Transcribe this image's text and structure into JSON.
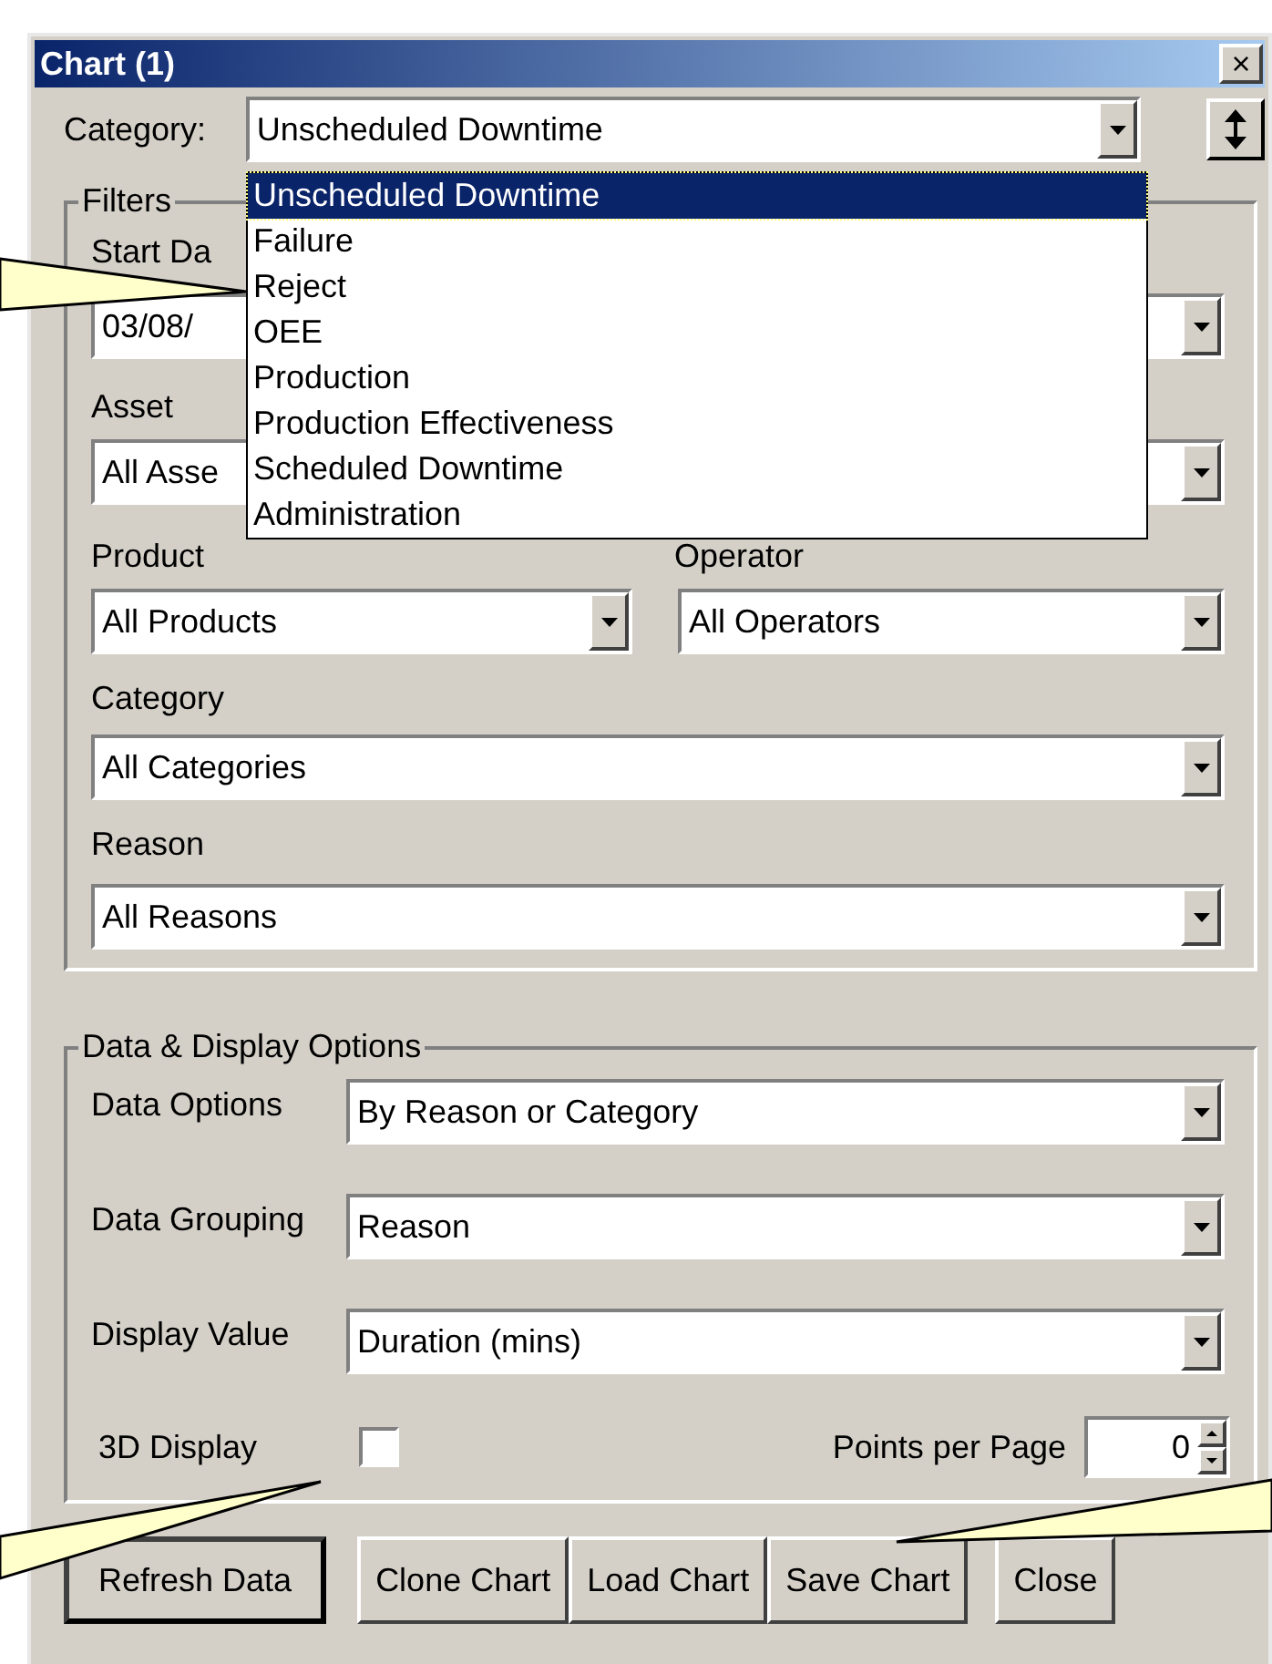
{
  "window": {
    "title": "Chart (1)",
    "close": "×"
  },
  "category": {
    "label": "Category:",
    "value": "Unscheduled Downtime",
    "expanded": true,
    "options": [
      {
        "label": "Unscheduled Downtime",
        "selected": true
      },
      {
        "label": "Failure",
        "selected": false
      },
      {
        "label": "Reject",
        "selected": false
      },
      {
        "label": "OEE",
        "selected": false
      },
      {
        "label": "Production",
        "selected": false
      },
      {
        "label": "Production Effectiveness",
        "selected": false
      },
      {
        "label": "Scheduled Downtime",
        "selected": false
      },
      {
        "label": "Administration",
        "selected": false
      }
    ]
  },
  "filters": {
    "title": "Filters",
    "start_label": "Start Da",
    "start_value": "03/08/",
    "asset_label": "Asset",
    "asset_value": "All Asse",
    "product_label": "Product",
    "product_value": "All Products",
    "operator_label": "Operator",
    "operator_value": "All Operators",
    "category_label": "Category",
    "category_value": "All Categories",
    "reason_label": "Reason",
    "reason_value": "All Reasons"
  },
  "display": {
    "title": "Data & Display Options",
    "rows": [
      {
        "label": "Data Options",
        "value": "By Reason or Category"
      },
      {
        "label": "Data Grouping",
        "value": "Reason"
      },
      {
        "label": "Display Value",
        "value": "Duration (mins)"
      }
    ],
    "three_d_label": "3D Display",
    "three_d_checked": false,
    "points_label": "Points per Page",
    "points_value": "0"
  },
  "buttons": [
    {
      "label": "Refresh Data",
      "default": true
    },
    {
      "label": "Clone Chart",
      "default": false
    },
    {
      "label": "Load Chart",
      "default": false
    },
    {
      "label": "Save Chart",
      "default": false
    },
    {
      "label": "Close",
      "default": false
    }
  ]
}
